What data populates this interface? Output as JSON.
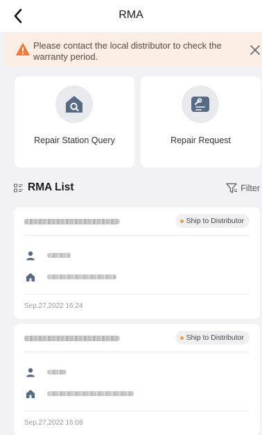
{
  "header": {
    "title": "RMA"
  },
  "notice": {
    "text": "Please contact the local distributor to check the warranty period."
  },
  "services": [
    {
      "label": "Repair Station Query"
    },
    {
      "label": "Repair Request"
    }
  ],
  "rma_list": {
    "title": "RMA List",
    "filter_label": "Filter",
    "items": [
      {
        "status": "Ship to Distributor",
        "date": "Sep.27,2022 16:24"
      },
      {
        "status": "Ship to Distributor",
        "date": "Sep.27,2022 16:08"
      }
    ]
  },
  "colors": {
    "warning": "#f07a3a",
    "status_dot": "#f39a3c",
    "icon_slate": "#586b85",
    "notice_bg": "#fbeee5"
  }
}
